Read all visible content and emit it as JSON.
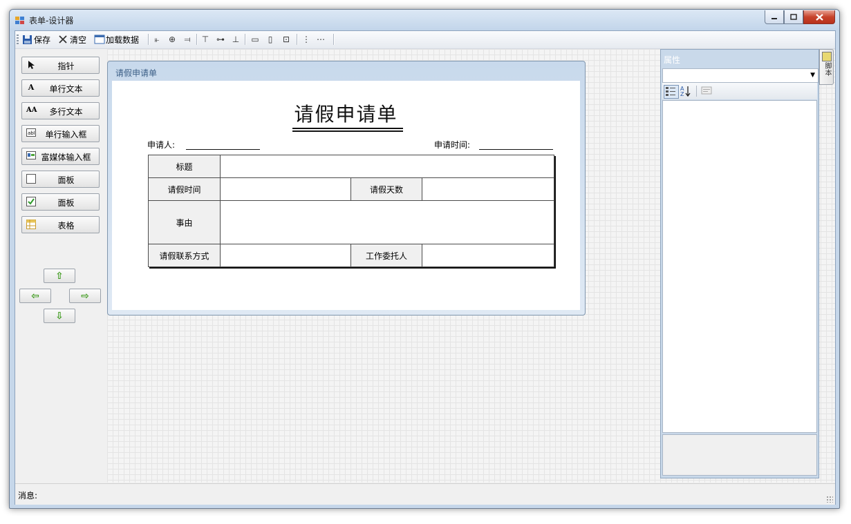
{
  "window": {
    "title": "表单-设计器"
  },
  "toolbar": {
    "save_label": "保存",
    "clear_label": "清空",
    "load_label": "加载数据"
  },
  "toolbox": {
    "items": [
      {
        "label": "指针",
        "icon": "pointer-icon"
      },
      {
        "label": "单行文本",
        "icon": "text-icon"
      },
      {
        "label": "多行文本",
        "icon": "multitext-icon"
      },
      {
        "label": "单行输入框",
        "icon": "textbox-icon"
      },
      {
        "label": "富媒体输入框",
        "icon": "richtext-icon"
      },
      {
        "label": "面板",
        "icon": "panel-icon"
      },
      {
        "label": "面板",
        "icon": "checkbox-icon"
      },
      {
        "label": "表格",
        "icon": "table-icon"
      }
    ]
  },
  "form": {
    "panel_header": "请假申请单",
    "title": "请假申请单",
    "applicant_label": "申请人:",
    "apply_time_label": "申请时间:",
    "table": {
      "subject": "标题",
      "leave_time": "请假时间",
      "leave_days": "请假天数",
      "reason": "事由",
      "contact": "请假联系方式",
      "delegate": "工作委托人"
    }
  },
  "properties": {
    "title": "属性",
    "side_tab_label": "脚本"
  },
  "status": {
    "message_label": "消息:"
  },
  "colors": {
    "accent_green": "#3d9a1c",
    "close_red": "#c7432c",
    "panel_blue": "#c8d9ec"
  }
}
